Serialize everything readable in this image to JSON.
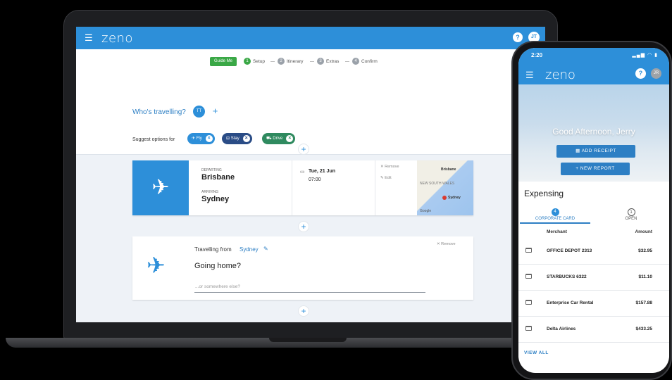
{
  "laptop": {
    "header": {
      "logo": "zeno",
      "menu_icon": "hamburger-icon",
      "help_label": "?",
      "avatar_initials": "JT"
    },
    "steps": {
      "guide_label": "Guide Me",
      "items": [
        {
          "number": "1",
          "label": "Setup"
        },
        {
          "number": "2",
          "label": "Itinerary"
        },
        {
          "number": "3",
          "label": "Extras"
        },
        {
          "number": "4",
          "label": "Confirm"
        }
      ]
    },
    "travellers": {
      "label": "Who's travelling?",
      "initials": "TT",
      "add_label": "+"
    },
    "suggest": {
      "label": "Suggest options for",
      "chips": [
        {
          "icon": "✈",
          "label": "Fly"
        },
        {
          "icon": "⊟",
          "label": "Stay"
        },
        {
          "icon": "⛟",
          "label": "Drive"
        }
      ]
    },
    "flight": {
      "departing_label": "Departing",
      "departing_city": "Brisbane",
      "arriving_label": "Arriving",
      "arriving_city": "Sydney",
      "date": "Tue, 21 Jun",
      "time": "07:00",
      "remove_label": "Remove",
      "edit_label": "Edit",
      "map": {
        "brisbane": "Brisbane",
        "sydney": "Sydney",
        "nsw": "NEW SOUTH WALES",
        "google": "Google"
      }
    },
    "travel_from": {
      "label": "Travelling from",
      "city": "Sydney",
      "question": "Going home?",
      "placeholder": "...or somewhere else?",
      "remove_label": "Remove"
    },
    "plus_label": "+"
  },
  "phone": {
    "status": {
      "time": "2:20",
      "icons": "▂▄▆ ◠ ▮"
    },
    "header": {
      "logo": "zeno",
      "help_label": "?",
      "avatar_initials": "JR"
    },
    "greeting": "Good Afternoon, Jerry",
    "add_receipt": "ADD RECEIPT",
    "new_report": "+ NEW REPORT",
    "section_title": "Expensing",
    "tabs": [
      {
        "count": "4",
        "label": "CORPORATE CARD"
      },
      {
        "count": "1",
        "label": "OPEN"
      }
    ],
    "columns": {
      "merchant": "Merchant",
      "amount": "Amount"
    },
    "rows": [
      {
        "merchant": "OFFICE DEPOT 2313",
        "amount": "$32.95"
      },
      {
        "merchant": "STARBUCKS 6322",
        "amount": "$11.10"
      },
      {
        "merchant": "Enterprise Car Rental",
        "amount": "$157.88"
      },
      {
        "merchant": "Delta Airlines",
        "amount": "$433.25"
      }
    ],
    "view_all": "VIEW ALL"
  }
}
